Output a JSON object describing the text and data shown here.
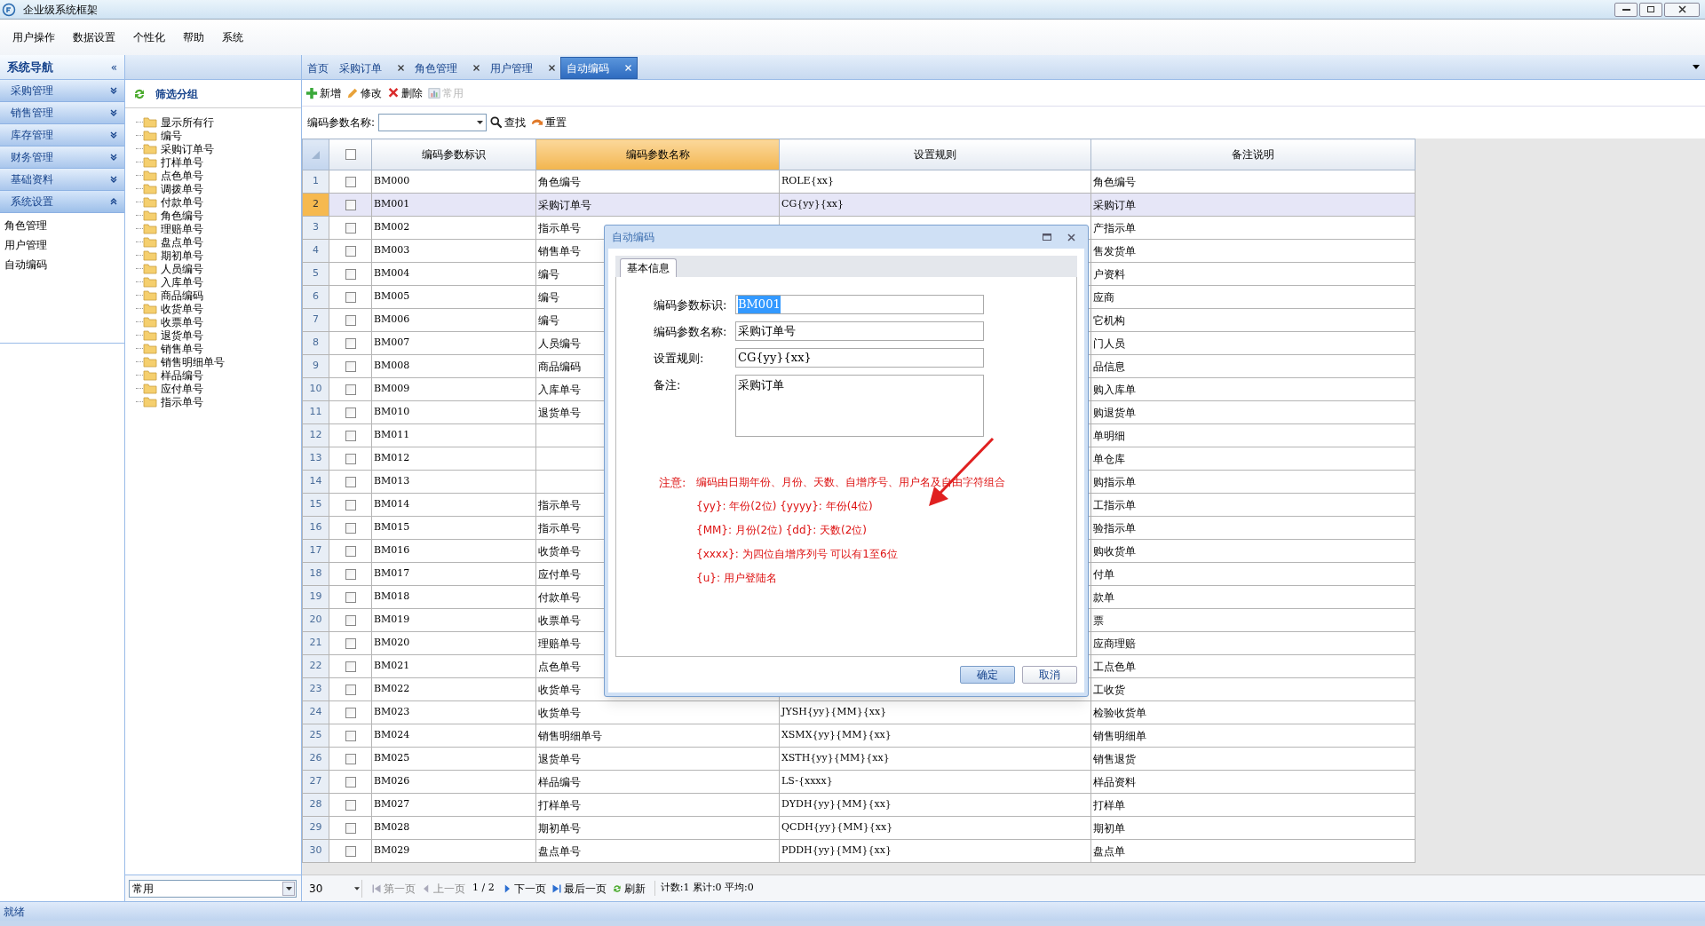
{
  "window": {
    "title": "企业级系统框架"
  },
  "menu": [
    "用户操作",
    "数据设置",
    "个性化",
    "帮助",
    "系统"
  ],
  "nav": {
    "title": "系统导航",
    "collapse_glyph": "«",
    "sections": [
      {
        "label": "采购管理",
        "expanded": false
      },
      {
        "label": "销售管理",
        "expanded": false
      },
      {
        "label": "库存管理",
        "expanded": false
      },
      {
        "label": "财务管理",
        "expanded": false
      },
      {
        "label": "基础资料",
        "expanded": false
      },
      {
        "label": "系统设置",
        "expanded": true,
        "items": [
          "角色管理",
          "用户管理",
          "自动编码"
        ]
      }
    ]
  },
  "tree": {
    "title": "筛选分组",
    "items": [
      "显示所有行",
      "编号",
      "采购订单号",
      "打样单号",
      "点色单号",
      "调拨单号",
      "付款单号",
      "角色编号",
      "理赔单号",
      "盘点单号",
      "期初单号",
      "人员编号",
      "入库单号",
      "商品编码",
      "收货单号",
      "收票单号",
      "退货单号",
      "销售单号",
      "销售明细单号",
      "样品编号",
      "应付单号",
      "指示单号"
    ],
    "filter": "常用"
  },
  "tabs": [
    {
      "label": "首页",
      "closable": false,
      "selected": false
    },
    {
      "label": "采购订单",
      "closable": true,
      "selected": false
    },
    {
      "label": "角色管理",
      "closable": true,
      "selected": false
    },
    {
      "label": "用户管理",
      "closable": true,
      "selected": false
    },
    {
      "label": "自动编码",
      "closable": true,
      "selected": true
    }
  ],
  "toolbar": [
    {
      "label": "新增",
      "kind": "add",
      "disabled": false
    },
    {
      "label": "修改",
      "kind": "edit",
      "disabled": false
    },
    {
      "label": "删除",
      "kind": "delete",
      "disabled": false
    },
    {
      "label": "常用",
      "kind": "chart",
      "disabled": true
    }
  ],
  "search": {
    "label": "编码参数名称:",
    "buttons": [
      {
        "label": "查找",
        "kind": "search"
      },
      {
        "label": "重置",
        "kind": "reset"
      }
    ]
  },
  "table": {
    "all_checked": false,
    "columns": [
      {
        "label": "编码参数标识",
        "highlighted": false
      },
      {
        "label": "编码参数名称",
        "highlighted": true
      },
      {
        "label": "设置规则",
        "highlighted": false
      },
      {
        "label": "备注说明",
        "highlighted": false
      }
    ],
    "rows": [
      {
        "no": "1",
        "checked": false,
        "selected": false,
        "id": "BM000",
        "name": "角色编号",
        "rule": "ROLE{xx}",
        "remark": "角色编号"
      },
      {
        "no": "2",
        "checked": false,
        "selected": true,
        "id": "BM001",
        "name": "采购订单号",
        "rule": "CG{yy}{xx}",
        "remark": "采购订单"
      },
      {
        "no": "3",
        "checked": false,
        "selected": false,
        "id": "BM002",
        "name": "指示单号",
        "remark": "产指示单"
      },
      {
        "no": "4",
        "checked": false,
        "selected": false,
        "id": "BM003",
        "name": "销售单号",
        "remark": "售发货单"
      },
      {
        "no": "5",
        "checked": false,
        "selected": false,
        "id": "BM004",
        "name": "编号",
        "remark": "户资料"
      },
      {
        "no": "6",
        "checked": false,
        "selected": false,
        "id": "BM005",
        "name": "编号",
        "remark": "应商"
      },
      {
        "no": "7",
        "checked": false,
        "selected": false,
        "id": "BM006",
        "name": "编号",
        "remark": "它机构"
      },
      {
        "no": "8",
        "checked": false,
        "selected": false,
        "id": "BM007",
        "name": "人员编号",
        "remark": "门人员"
      },
      {
        "no": "9",
        "checked": false,
        "selected": false,
        "id": "BM008",
        "name": "商品编码",
        "remark": "品信息"
      },
      {
        "no": "10",
        "checked": false,
        "selected": false,
        "id": "BM009",
        "name": "入库单号",
        "remark": "购入库单"
      },
      {
        "no": "11",
        "checked": false,
        "selected": false,
        "id": "BM010",
        "name": "退货单号",
        "remark": "购退货单"
      },
      {
        "no": "12",
        "checked": false,
        "selected": false,
        "id": "BM011",
        "remark": "单明细"
      },
      {
        "no": "13",
        "checked": false,
        "selected": false,
        "id": "BM012",
        "remark": "单仓库"
      },
      {
        "no": "14",
        "checked": false,
        "selected": false,
        "id": "BM013",
        "remark": "购指示单"
      },
      {
        "no": "15",
        "checked": false,
        "selected": false,
        "id": "BM014",
        "name": "指示单号",
        "remark": "工指示单"
      },
      {
        "no": "16",
        "checked": false,
        "selected": false,
        "id": "BM015",
        "name": "指示单号",
        "remark": "验指示单"
      },
      {
        "no": "17",
        "checked": false,
        "selected": false,
        "id": "BM016",
        "name": "收货单号",
        "remark": "购收货单"
      },
      {
        "no": "18",
        "checked": false,
        "selected": false,
        "id": "BM017",
        "name": "应付单号",
        "remark": "付单"
      },
      {
        "no": "19",
        "checked": false,
        "selected": false,
        "id": "BM018",
        "name": "付款单号",
        "remark": "款单"
      },
      {
        "no": "20",
        "checked": false,
        "selected": false,
        "id": "BM019",
        "name": "收票单号",
        "remark": "票"
      },
      {
        "no": "21",
        "checked": false,
        "selected": false,
        "id": "BM020",
        "name": "理赔单号",
        "remark": "应商理赔"
      },
      {
        "no": "22",
        "checked": false,
        "selected": false,
        "id": "BM021",
        "name": "点色单号",
        "remark": "工点色单"
      },
      {
        "no": "23",
        "checked": false,
        "selected": false,
        "id": "BM022",
        "name": "收货单号",
        "remark": "工收货"
      },
      {
        "no": "24",
        "checked": false,
        "selected": false,
        "id": "BM023",
        "name": "收货单号",
        "rule": "JYSH{yy}{MM}{xx}",
        "remark": "检验收货单"
      },
      {
        "no": "25",
        "checked": false,
        "selected": false,
        "id": "BM024",
        "name": "销售明细单号",
        "rule": "XSMX{yy}{MM}{xx}",
        "remark": "销售明细单"
      },
      {
        "no": "26",
        "checked": false,
        "selected": false,
        "id": "BM025",
        "name": "退货单号",
        "rule": "XSTH{yy}{MM}{xx}",
        "remark": "销售退货"
      },
      {
        "no": "27",
        "checked": false,
        "selected": false,
        "id": "BM026",
        "name": "样品编号",
        "rule": "LS-{xxxx}",
        "remark": "样品资料"
      },
      {
        "no": "28",
        "checked": false,
        "selected": false,
        "id": "BM027",
        "name": "打样单号",
        "rule": "DYDH{yy}{MM}{xx}",
        "remark": "打样单"
      },
      {
        "no": "29",
        "checked": false,
        "selected": false,
        "id": "BM028",
        "name": "期初单号",
        "rule": "QCDH{yy}{MM}{xx}",
        "remark": "期初单"
      },
      {
        "no": "30",
        "checked": false,
        "selected": false,
        "id": "BM029",
        "name": "盘点单号",
        "rule": "PDDH{yy}{MM}{xx}",
        "remark": "盘点单"
      }
    ]
  },
  "pager": {
    "page_size": "30",
    "buttons": [
      {
        "label": "第一页",
        "kind": "first",
        "disabled": true
      },
      {
        "label": "上一页",
        "kind": "prev",
        "disabled": true
      },
      {
        "label": "1 / 2",
        "kind": "info"
      },
      {
        "label": "下一页",
        "kind": "next",
        "disabled": false
      },
      {
        "label": "最后一页",
        "kind": "last",
        "disabled": false
      },
      {
        "label": "刷新",
        "kind": "refresh",
        "disabled": false
      }
    ],
    "stats": "计数:1 累计:0 平均:0"
  },
  "dialog": {
    "title": "自动编码",
    "tab": "基本信息",
    "fields": [
      {
        "label": "编码参数标识:",
        "value": "BM001",
        "kind": "input",
        "selected": true
      },
      {
        "label": "编码参数名称:",
        "value": "采购订单号",
        "kind": "input",
        "selected": false
      },
      {
        "label": "设置规则:",
        "value": "CG{yy}{xx}",
        "kind": "input",
        "selected": false
      },
      {
        "label": "备注:",
        "value": "采购订单",
        "kind": "textarea",
        "selected": false
      }
    ],
    "note_label": "注意:",
    "notes": [
      "编码由日期年份、月份、天数、自增序号、用户名及自由字符组合",
      "{yy}: 年份(2位) {yyyy}: 年份(4位)",
      "{MM}: 月份(2位) {dd}: 天数(2位)",
      "{xxxx}: 为四位自增序列号 可以有1至6位",
      "{u}: 用户登陆名"
    ],
    "buttons": [
      {
        "label": "确定",
        "primary": true
      },
      {
        "label": "取消",
        "primary": false
      }
    ]
  },
  "status_bar": "就绪"
}
